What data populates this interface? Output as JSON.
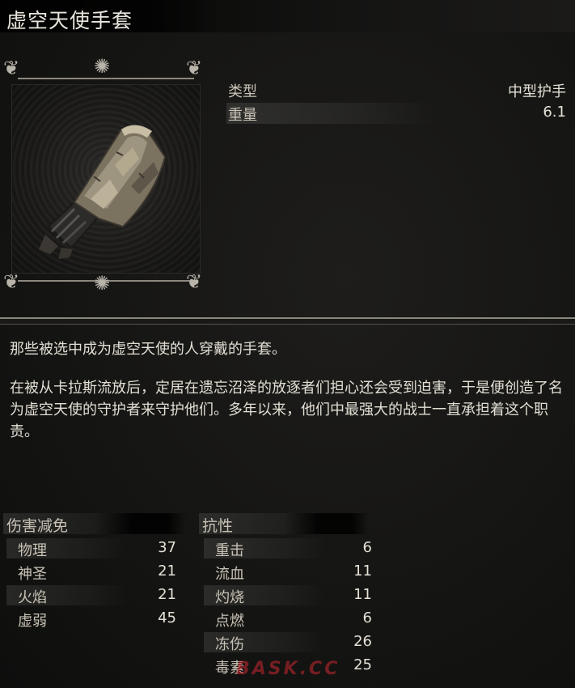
{
  "item": {
    "name": "虚空天使手套"
  },
  "stats": [
    {
      "label": "类型",
      "value": "中型护手"
    },
    {
      "label": "重量",
      "value": "6.1"
    }
  ],
  "description": {
    "line1": "那些被选中成为虚空天使的人穿戴的手套。",
    "paragraph2": "在被从卡拉斯流放后，定居在遗忘沼泽的放逐者们担心还会受到迫害，于是便创造了名为虚空天使的守护者来守护他们。多年以来，他们中最强大的战士一直承担着这个职责。"
  },
  "damage_reduction": {
    "header": "伤害减免",
    "rows": [
      {
        "label": "物理",
        "value": "37"
      },
      {
        "label": "神圣",
        "value": "21"
      },
      {
        "label": "火焰",
        "value": "21"
      },
      {
        "label": "虚弱",
        "value": "45"
      }
    ]
  },
  "resistance": {
    "header": "抗性",
    "rows": [
      {
        "label": "重击",
        "value": "6"
      },
      {
        "label": "流血",
        "value": "11"
      },
      {
        "label": "灼烧",
        "value": "11"
      },
      {
        "label": "点燃",
        "value": "6"
      },
      {
        "label": "冻伤",
        "value": "26"
      },
      {
        "label": "毒素",
        "value": "25"
      }
    ]
  },
  "watermark": "BASK.CC",
  "icons": {
    "ornament": "filigree-ornament-icon",
    "item": "gauntlet-icon"
  },
  "colors": {
    "background": "#151513",
    "text": "#d6d2c8",
    "divider": "#8a877f"
  }
}
